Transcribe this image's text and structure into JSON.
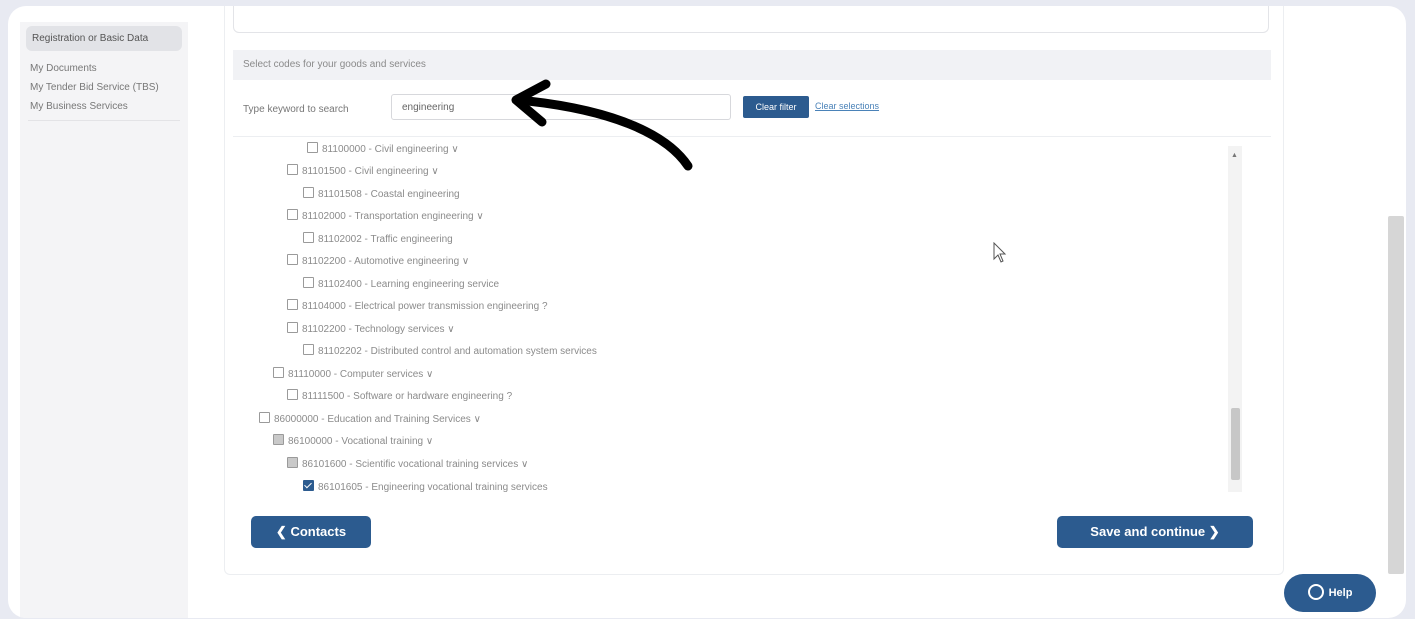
{
  "sidebar": {
    "items": [
      {
        "label": "Registration or Basic Data",
        "active": true
      },
      {
        "label": "My Documents",
        "active": false
      },
      {
        "label": "My Tender Bid Service (TBS)",
        "active": false
      },
      {
        "label": "My Business Services",
        "active": false
      }
    ]
  },
  "main": {
    "section_header": "Select codes for your goods and services",
    "search_label": "Type keyword to search",
    "search_value": "engineering",
    "clear_filter_label": "Clear filter",
    "clear_selections_label": "Clear selections",
    "tree": [
      {
        "label": "81100000 - Civil engineering ∨",
        "state": "none"
      },
      {
        "label": "81101500 - Civil engineering ∨",
        "state": "none"
      },
      {
        "label": "81101508 - Coastal engineering",
        "state": "none"
      },
      {
        "label": "81102000 - Transportation engineering ∨",
        "state": "none"
      },
      {
        "label": "81102002 - Traffic engineering",
        "state": "none"
      },
      {
        "label": "81102200 - Automotive engineering ∨",
        "state": "none"
      },
      {
        "label": "81102400 - Learning engineering service",
        "state": "none"
      },
      {
        "label": "81104000 - Electrical power transmission engineering ?",
        "state": "none"
      },
      {
        "label": "81102200 - Technology services ∨",
        "state": "none"
      },
      {
        "label": "81102202 - Distributed control and automation system services",
        "state": "none"
      },
      {
        "label": "81110000 - Computer services ∨",
        "state": "none"
      },
      {
        "label": "81111500 - Software or hardware engineering ?",
        "state": "none"
      },
      {
        "label": "86000000 - Education and Training Services ∨",
        "state": "none"
      },
      {
        "label": "86100000 - Vocational training ∨",
        "state": "partial"
      },
      {
        "label": "86101600 - Scientific vocational training services ∨",
        "state": "partial"
      },
      {
        "label": "86101605 - Engineering vocational training services",
        "state": "checked"
      }
    ]
  },
  "buttons": {
    "contacts": "Contacts",
    "save_continue": "Save and continue",
    "help": "Help"
  },
  "colors": {
    "primary": "#2c5b8f",
    "link": "#4a82b8"
  }
}
